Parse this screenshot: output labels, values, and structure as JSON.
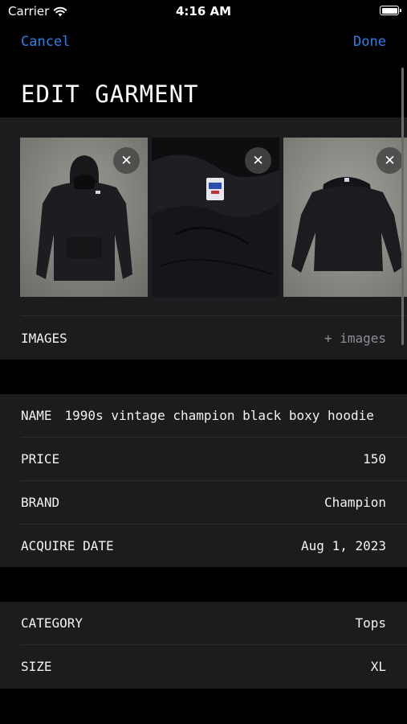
{
  "status_bar": {
    "carrier": "Carrier",
    "time": "4:16 AM",
    "wifi_icon": "wifi-icon",
    "battery_icon": "battery-icon"
  },
  "nav": {
    "cancel_label": "Cancel",
    "done_label": "Done"
  },
  "title": "EDIT GARMENT",
  "images_section": {
    "thumbnails": [
      {
        "name": "hoodie-front-photo",
        "remove_icon": "close-icon",
        "remove_label": "✕"
      },
      {
        "name": "hoodie-tag-closeup-photo",
        "remove_icon": "close-icon",
        "remove_label": "✕"
      },
      {
        "name": "hoodie-back-photo",
        "remove_icon": "close-icon",
        "remove_label": "✕"
      }
    ],
    "label": "IMAGES",
    "add_label": "+ images"
  },
  "details": {
    "name_label": "NAME",
    "name_value": "1990s vintage champion black boxy hoodie",
    "price_label": "PRICE",
    "price_value": "150",
    "brand_label": "BRAND",
    "brand_value": "Champion",
    "date_label": "ACQUIRE DATE",
    "date_value": "Aug 1, 2023"
  },
  "classification": {
    "category_label": "CATEGORY",
    "category_value": "Tops",
    "size_label": "SIZE",
    "size_value": "XL"
  },
  "colors": {
    "accent": "#2f7fe8",
    "background": "#000000",
    "card": "#1c1c1e",
    "muted": "#8e8e93"
  }
}
